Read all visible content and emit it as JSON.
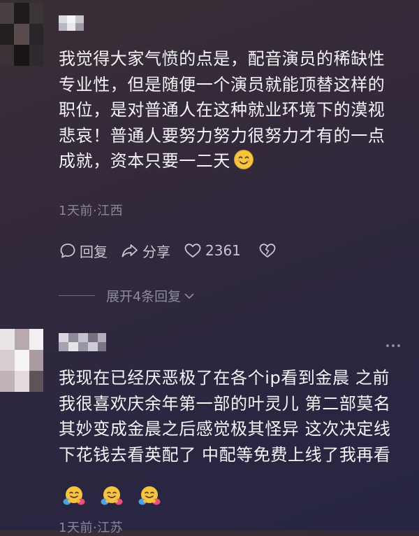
{
  "comments": [
    {
      "text": "我觉得大家气愤的点是，配音演员的稀缺性\n专业性，但是随便一个演员就能顶替这样的\n职位，是对普通人在这种就业环境下的漠视\n悲哀！普通人要努力努力很努力才有的一点\n成就，资本只要一二天",
      "inline_emoji": "smiling-face-emoji",
      "meta": "1天前·江西",
      "reply_label": "回复",
      "share_label": "分享",
      "like_count": "2361",
      "expand_label": "展开4条回复"
    },
    {
      "text": "我现在已经厌恶极了在各个ip看到金晨 之前\n我很喜欢庆余年第一部的叶灵儿 第二部莫名\n其妙变成金晨之后感觉极其怪异 这次决定线\n下花钱去看英配了 中配等免费上线了我再看",
      "emojis": [
        "hugging-face-emoji",
        "hugging-face-emoji",
        "hugging-face-emoji"
      ],
      "meta": "1天前·江苏"
    }
  ],
  "colors": {
    "text": "#f4f4f7",
    "meta": "#8a879a",
    "action": "#c9c7d3",
    "emoji_face": "#f5c542"
  }
}
